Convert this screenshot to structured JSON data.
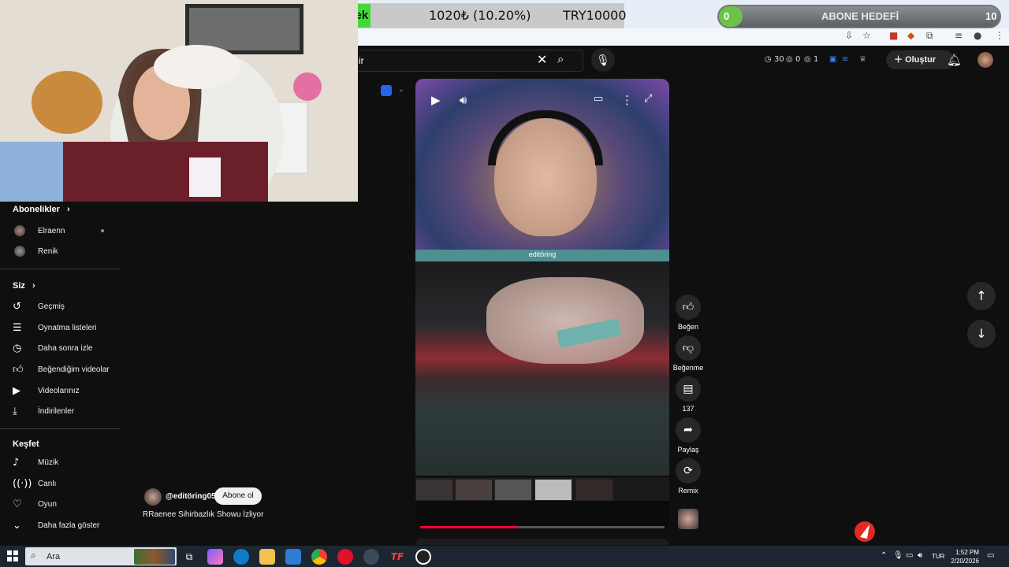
{
  "donation": {
    "title": "Destek",
    "amount": "1020₺ (10.20%)",
    "goal": "TRY10000",
    "accent": "#45d83a"
  },
  "sub_goal": {
    "start": "0",
    "label": "ABONE HEDEFİ",
    "end": "10",
    "progress": 0.0,
    "fill_color": "#6cc24a"
  },
  "search": {
    "value": "ir"
  },
  "top_stats": {
    "timer": "30",
    "views": "0",
    "likes": "1"
  },
  "header": {
    "create_label": "Oluştur"
  },
  "sidebar": {
    "subs_title": "Abonelikler",
    "channels": [
      {
        "label": "Elraenn",
        "live": true
      },
      {
        "label": "Renik"
      }
    ],
    "you_title": "Siz",
    "you_items": [
      {
        "icon": "history-icon",
        "label": "Geçmiş"
      },
      {
        "icon": "playlist-icon",
        "label": "Oynatma listeleri"
      },
      {
        "icon": "clock-icon",
        "label": "Daha sonra izle"
      },
      {
        "icon": "thumbs-up-icon",
        "label": "Beğendiğim videolar"
      },
      {
        "icon": "video-icon",
        "label": "Videolarınız"
      },
      {
        "icon": "download-icon",
        "label": "İndirilenler"
      }
    ],
    "explore_title": "Keşfet",
    "explore_items": [
      {
        "icon": "music-icon",
        "label": "Müzik"
      },
      {
        "icon": "live-icon",
        "label": "Canlı"
      },
      {
        "icon": "game-icon",
        "label": "Oyun"
      },
      {
        "icon": "chevron-down-icon",
        "label": "Daha fazla göster"
      }
    ]
  },
  "short": {
    "caption": "editöring",
    "progress": 0.4,
    "progress_color": "#ff0033"
  },
  "actions": {
    "like_label": "Beğen",
    "dislike_label": "Beğenme",
    "comments_count": "137",
    "share_label": "Paylaş",
    "remix_label": "Remix"
  },
  "channel": {
    "handle": "@editöring05",
    "subscribe_label": "Abone ol",
    "watching_text": "RRaenee Sihirbazlık Showu İzliyor"
  },
  "taskbar": {
    "search_placeholder": "Ara",
    "lang": "TUR",
    "time": "1:52 PM",
    "date": "2/20/2026"
  }
}
